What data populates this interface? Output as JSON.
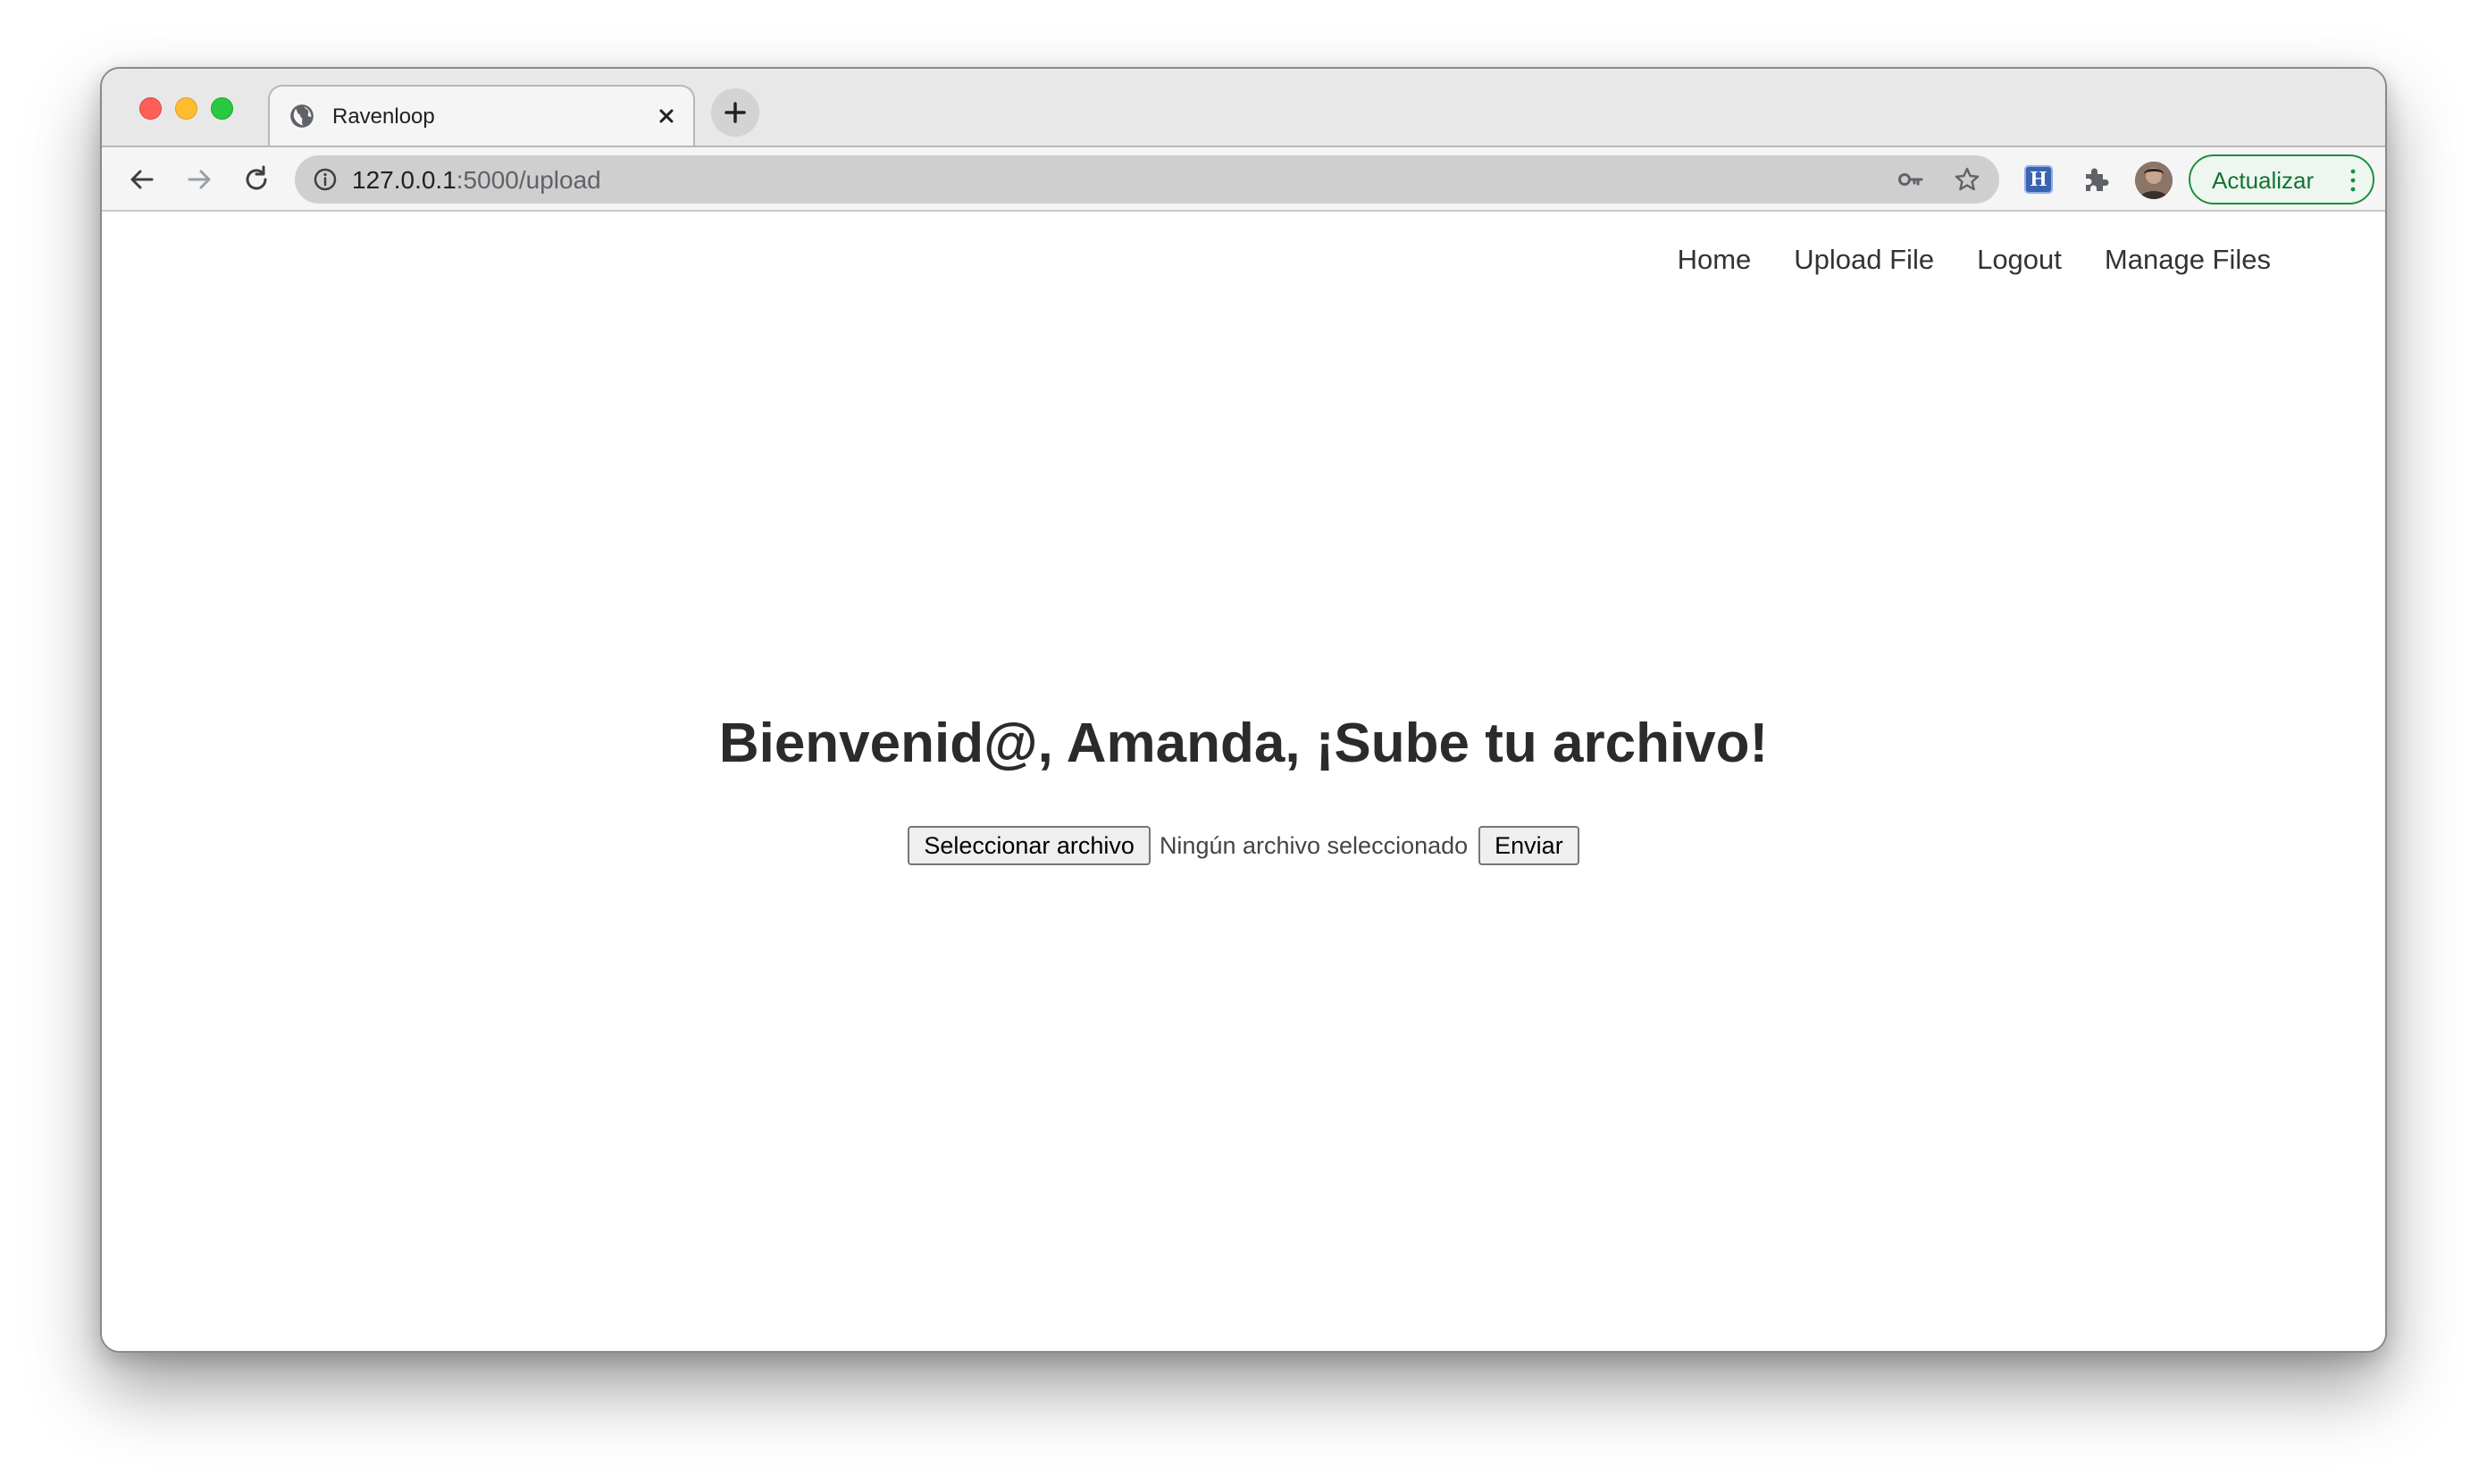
{
  "browser": {
    "tab": {
      "title": "Ravenloop",
      "favicon": "globe-icon"
    },
    "new_tab_label": "+",
    "address": {
      "host": "127.0.0.1",
      "path": ":5000/upload"
    },
    "extension_label": "H",
    "update_label": "Actualizar",
    "accent_green": "#1e8e3e"
  },
  "nav": {
    "items": [
      {
        "label": "Home"
      },
      {
        "label": "Upload File"
      },
      {
        "label": "Logout"
      },
      {
        "label": "Manage Files"
      }
    ]
  },
  "main": {
    "heading": "Bienvenid@, Amanda, ¡Sube tu archivo!",
    "file_button_label": "Seleccionar archivo",
    "file_status": "Ningún archivo seleccionado",
    "submit_label": "Enviar"
  }
}
